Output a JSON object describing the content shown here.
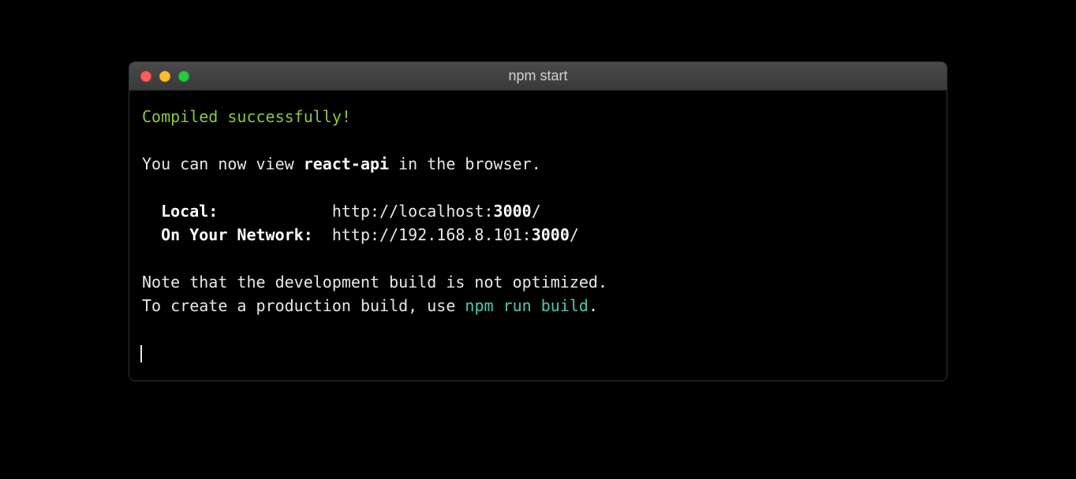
{
  "window": {
    "title": "npm start"
  },
  "output": {
    "status_line": "Compiled successfully!",
    "view_prefix": "You can now view ",
    "app_name": "react-api",
    "view_suffix": " in the browser.",
    "local_label": "Local:",
    "local_url_prefix": "http://localhost:",
    "local_port": "3000",
    "local_url_suffix": "/",
    "network_label": "On Your Network:",
    "network_url_prefix": "http://192.168.8.101:",
    "network_port": "3000",
    "network_url_suffix": "/",
    "note_line": "Note that the development build is not optimized.",
    "prod_prefix": "To create a production build, use ",
    "prod_command": "npm run build",
    "prod_suffix": "."
  }
}
